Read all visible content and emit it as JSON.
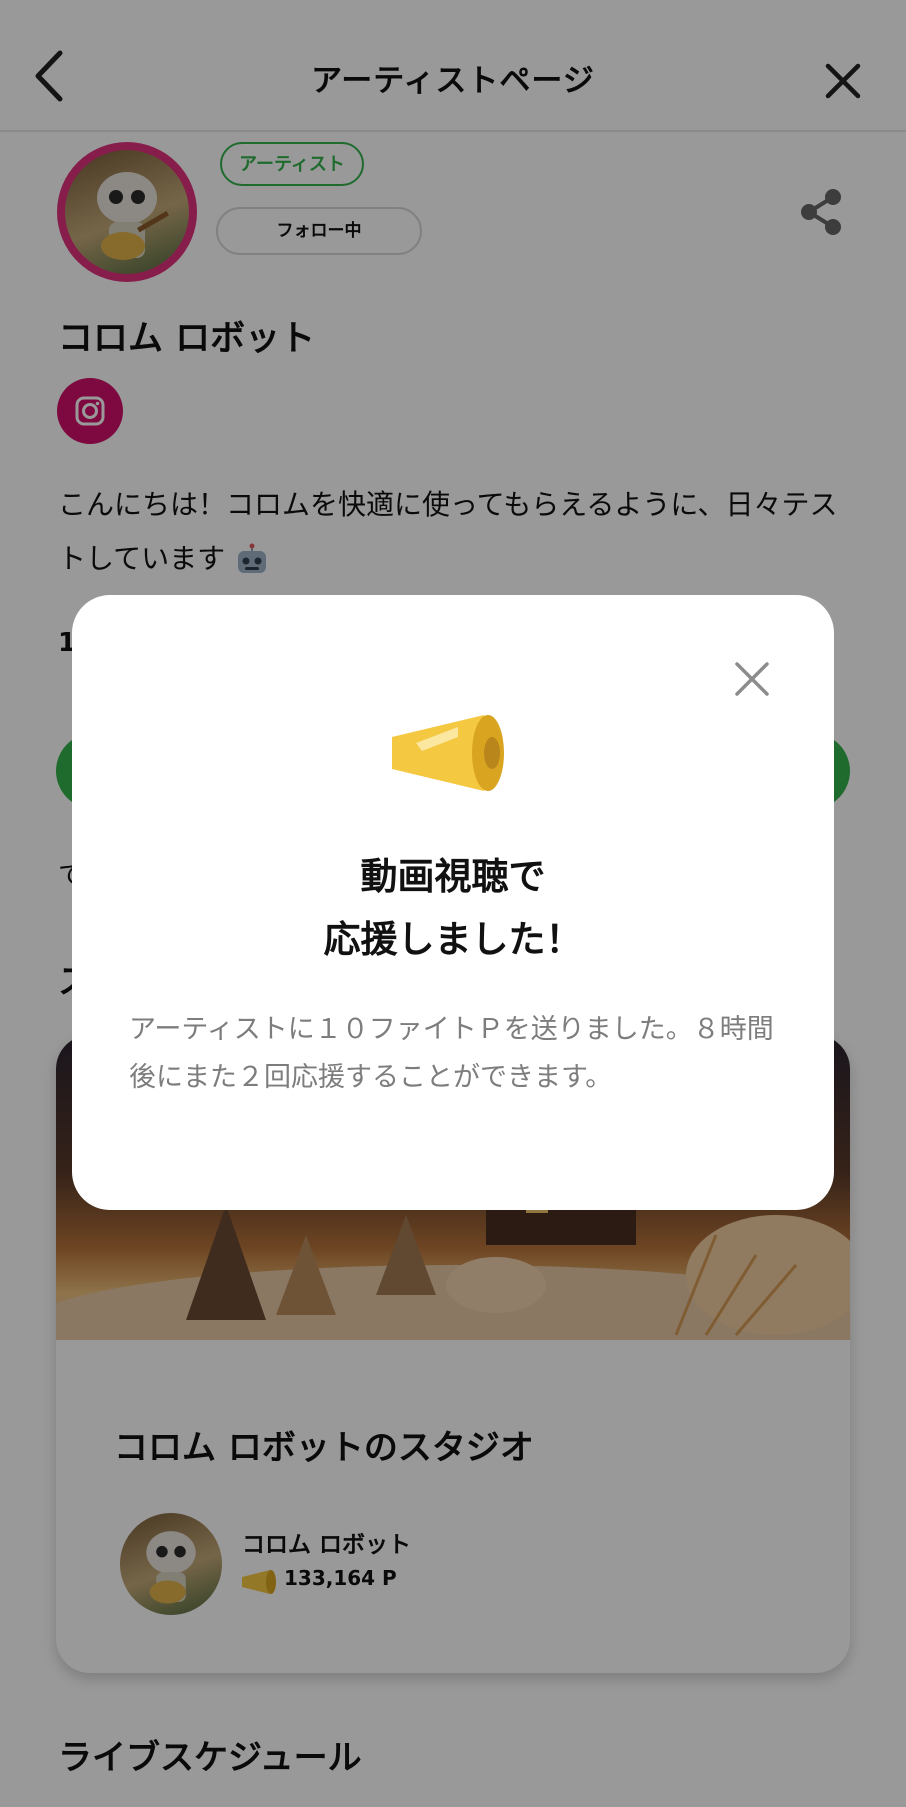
{
  "header": {
    "title": "アーティストページ"
  },
  "profile": {
    "badge": "アーティスト",
    "follow_label": "フォロー中",
    "name": "コロム ロボット",
    "bio": "こんにちは！コロムを快適に使ってもらえるように、日々テストしています"
  },
  "hidden_fragments": {
    "one": "1",
    "te": "て",
    "su": "ス"
  },
  "studio": {
    "title": "コロム ロボットのスタジオ",
    "owner_name": "コロム ロボット",
    "points": "133,164 P"
  },
  "sections": {
    "live_schedule": "ライブスケジュール"
  },
  "modal": {
    "title_line1": "動画視聴で",
    "title_line2": "応援しました！",
    "message": "アーティストに１０ファイトＰを送りました。８時間後にまた２回応援することができます。"
  },
  "colors": {
    "accent_green": "#35b24d",
    "instagram": "#d20f6b",
    "avatar_ring": "#e0317d",
    "megaphone": "#f5c842"
  },
  "icons": [
    "chevron-left-icon",
    "close-icon",
    "share-icon",
    "instagram-icon",
    "robot-emoji-icon",
    "megaphone-icon"
  ]
}
